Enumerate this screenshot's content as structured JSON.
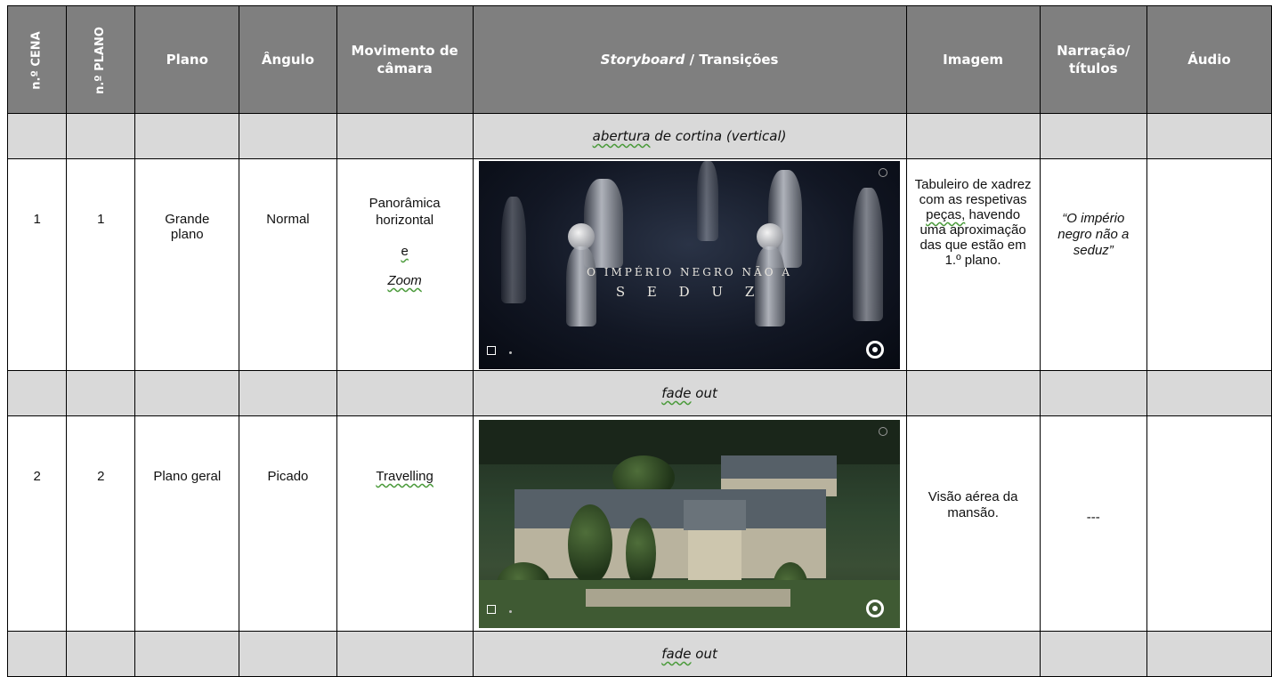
{
  "headers": {
    "cena": "n.º CENA",
    "plano_num": "n.º PLANO",
    "plano": "Plano",
    "angulo": "Ângulo",
    "movimento": "Movimento de câmara",
    "storyboard_italic": "Storyboard",
    "storyboard_rest": " / Transições",
    "imagem": "Imagem",
    "narracao": "Narração/ títulos",
    "audio": "Áudio"
  },
  "transitions": {
    "t1_word": "abertura",
    "t1_rest": " de cortina (vertical)",
    "t2_word": "fade",
    "t2_rest": " out",
    "t3_word": "fade",
    "t3_rest": " out"
  },
  "rows": [
    {
      "cena": "1",
      "plano_num": "1",
      "plano": "Grande plano",
      "angulo": "Normal",
      "movimento_line1": "Panorâmica horizontal",
      "movimento_line2": "e",
      "movimento_line3": "Zoom",
      "storyboard_title_line1": "O IMPÉRIO NEGRO NÃO A",
      "storyboard_title_line2": "S E D U Z",
      "imagem_a": "Tabuleiro de xadrez com as respetivas",
      "imagem_b": "peças,",
      "imagem_c": "havendo uma aproximação das que estão em 1.º plano.",
      "narracao": "“O império negro não a seduz”",
      "audio": ""
    },
    {
      "cena": "2",
      "plano_num": "2",
      "plano": "Plano geral",
      "angulo": "Picado",
      "movimento_line1": "Travelling",
      "imagem": "Visão aérea da mansão.",
      "narracao": "---",
      "audio": ""
    }
  ],
  "icons": {
    "play": "play-icon",
    "logo": "channel-logo-icon",
    "info": "info-icon"
  },
  "colors": {
    "header_bg": "#7f7f7f",
    "transition_row_bg": "#d9d9d9",
    "spellcheck_underline": "#4a9a3a"
  }
}
